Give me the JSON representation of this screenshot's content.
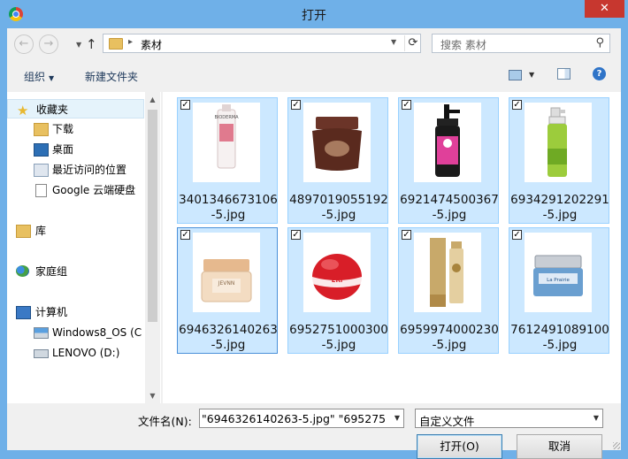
{
  "window": {
    "title": "打开",
    "close_glyph": "✕"
  },
  "nav": {
    "back_glyph": "←",
    "forward_glyph": "→",
    "up_glyph": "↑",
    "breadcrumb_sep": "▸",
    "address": "素材",
    "refresh_glyph": "⟳",
    "search_placeholder": "搜索 素材",
    "search_glyph": "⚲"
  },
  "toolbar": {
    "organize_label": "组织",
    "new_folder_label": "新建文件夹",
    "help_glyph": "?"
  },
  "sidebar": {
    "items": [
      {
        "label": "收藏夹",
        "icon": "star-icon"
      },
      {
        "label": "下载",
        "icon": "download-icon"
      },
      {
        "label": "桌面",
        "icon": "desktop-icon"
      },
      {
        "label": "最近访问的位置",
        "icon": "recent-places-icon"
      },
      {
        "label": "Google 云端硬盘",
        "icon": "document-icon"
      },
      {
        "label": "库",
        "icon": "library-icon"
      },
      {
        "label": "家庭组",
        "icon": "homegroup-icon"
      },
      {
        "label": "计算机",
        "icon": "computer-icon"
      },
      {
        "label": "Windows8_OS (C",
        "icon": "drive-c-icon"
      },
      {
        "label": "LENOVO (D:)",
        "icon": "drive-d-icon"
      }
    ]
  },
  "files": [
    {
      "name_line1": "3401346673106",
      "name_line2": "-5.jpg",
      "checked": true
    },
    {
      "name_line1": "4897019055192",
      "name_line2": "-5.jpg",
      "checked": true
    },
    {
      "name_line1": "6921474500367",
      "name_line2": "-5.jpg",
      "checked": true
    },
    {
      "name_line1": "6934291202291",
      "name_line2": "-5.jpg",
      "checked": true
    },
    {
      "name_line1": "6946326140263",
      "name_line2": "-5.jpg",
      "checked": true
    },
    {
      "name_line1": "6952751000300",
      "name_line2": "-5.jpg",
      "checked": true
    },
    {
      "name_line1": "6959974000230",
      "name_line2": "-5.jpg",
      "checked": true
    },
    {
      "name_line1": "7612491089100",
      "name_line2": "-5.jpg",
      "checked": true
    }
  ],
  "thumbnail_brand_texts": [
    "BIODERMA",
    "JEVNN",
    "ERi",
    "La Prairie"
  ],
  "bottom": {
    "filename_label": "文件名(N):",
    "filename_value": "\"6946326140263-5.jpg\" \"695275",
    "filetype_value": "自定义文件",
    "open_button": "打开(O)",
    "cancel_button": "取消"
  },
  "colors": {
    "frame": "#6fb0e8",
    "selection": "#cce8ff",
    "selection_border": "#99d1ff",
    "close": "#c7372f"
  }
}
